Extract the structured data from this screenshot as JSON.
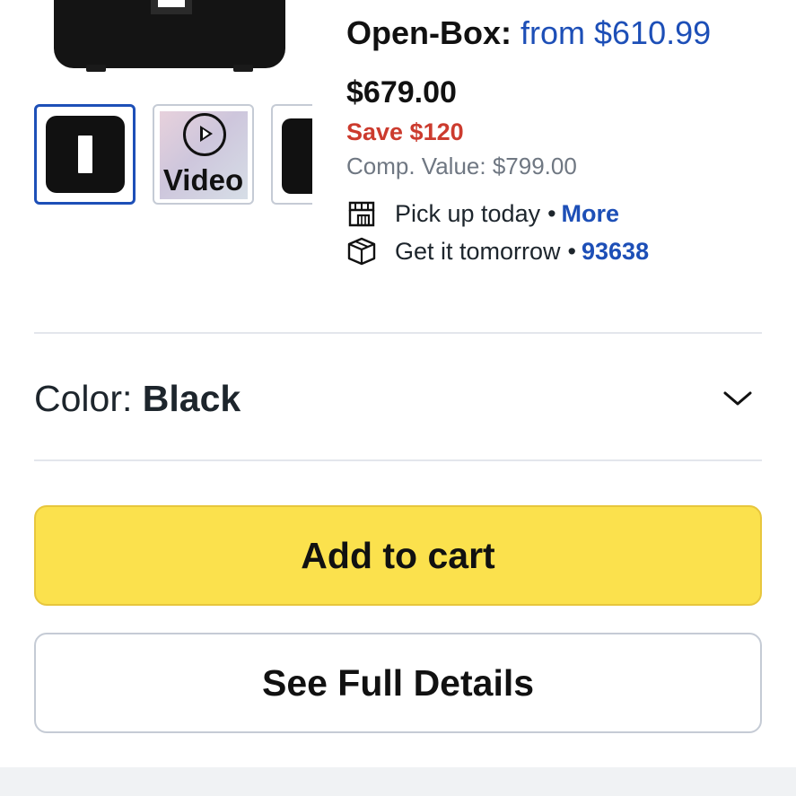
{
  "thumbnails": {
    "video_label": "Video"
  },
  "pricing": {
    "open_box_label": "Open-Box:",
    "open_box_value": "from $610.99",
    "price": "$679.00",
    "savings": "Save $120",
    "comp_value": "Comp. Value: $799.00"
  },
  "fulfillment": {
    "pickup_text": "Pick up today",
    "pickup_link": "More",
    "delivery_text": "Get it tomorrow",
    "delivery_link": "93638",
    "separator": "•"
  },
  "variant": {
    "label": "Color:",
    "value": "Black"
  },
  "actions": {
    "add_to_cart": "Add to cart",
    "see_details": "See Full Details"
  },
  "colors": {
    "link_blue": "#1d4fb7",
    "save_red": "#cc3b2e",
    "cart_yellow": "#fbe14d"
  },
  "icons": {
    "pickup": "store-pickup-icon",
    "delivery": "package-box-icon",
    "expand": "chevron-down-icon",
    "video": "play-circle-icon"
  }
}
